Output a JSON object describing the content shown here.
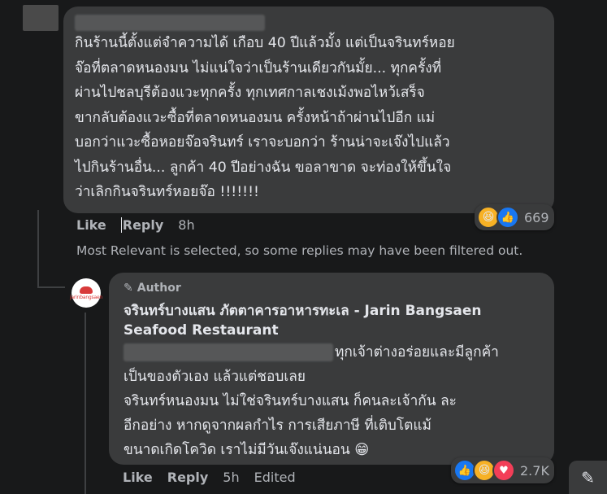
{
  "comment": {
    "text": "กินร้านนี้ตั้งแต่จำความได้ เกือบ 40 ปีแล้วมั้ง แต่เป็นจรินทร์หอย\nจ๊อที่ตลาดหนองมน ไม่แน่ใจว่าเป็นร้านเดียวกันมั้ย... ทุกครั้งที่\nผ่านไปชลบุรีต้องแวะทุกครั้ง ทุกเทศกาลเชงเม้งพอไหว้เสร็จ\nขากลับต้องแวะซื้อที่ตลาดหนองมน ครั้งหน้าถ้าผ่านไปอีก แม่\nบอกว่าแวะซื้อหอยจ๊อจรินทร์ เราจะบอกว่า ร้านน่าจะเจ๊งไปแล้ว\nไปกินร้านอื่น... ลูกค้า 40 ปีอย่างฉัน ขอลาขาด จะท่องให้ขึ้นใจ\nว่าเลิกกินจรินทร์หอยจ๊อ !!!!!!!",
    "reaction_count": "669",
    "reactions": [
      "haha-emoji",
      "like-icon"
    ],
    "like_label": "Like",
    "reply_label": "Reply",
    "time": "8h"
  },
  "filter_note": "Most Relevant is selected, so some replies may have been filtered out.",
  "reply": {
    "author_badge": "Author",
    "author_name": "จรินทร์บางแสน ภัตตาคารอาหารทะเล - Jarin Bangsaen\nSeafood Restaurant",
    "avatar_text": "jarinbangsaen",
    "text_first": "ทุกเจ้าต่างอร่อยและมีลูกค้า",
    "text_rest": "เป็นของตัวเอง แล้วแต่ชอบเลย\nจรินทร์หนองมน ไม่ใช่จรินทร์บางแสน ก็คนละเจ้ากัน ละ\nอีกอย่าง หากดูจากผลกำไร การเสียภาษี ที่เติบโตแม้\nขนาดเกิดโควิด เราไม่มีวันเจ๊งแน่นอน 😁",
    "reaction_count": "2.7K",
    "reactions": [
      "like-icon",
      "haha-emoji",
      "love-icon"
    ],
    "like_label": "Like",
    "reply_label": "Reply",
    "time": "5h",
    "edited_label": "Edited"
  },
  "icons": {
    "pencil": "pencil-icon",
    "edit": "edit-square-icon"
  }
}
